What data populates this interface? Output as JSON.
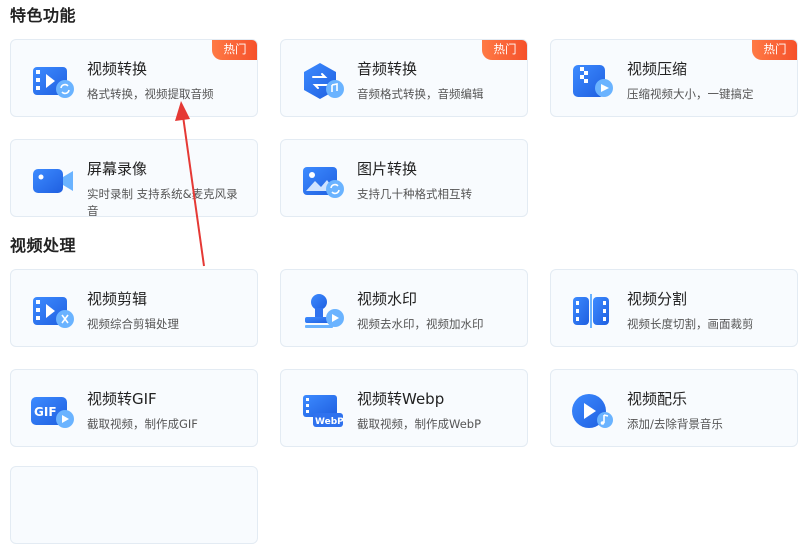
{
  "sections": [
    {
      "title": "特色功能"
    },
    {
      "title": "视频处理"
    }
  ],
  "featured": [
    {
      "title": "视频转换",
      "desc": "格式转换，视频提取音频",
      "badge": "热门",
      "icon": "video-convert-icon"
    },
    {
      "title": "音频转换",
      "desc": "音频格式转换，音频编辑",
      "badge": "热门",
      "icon": "audio-convert-icon"
    },
    {
      "title": "视频压缩",
      "desc": "压缩视频大小，一键搞定",
      "badge": "热门",
      "icon": "video-compress-icon"
    },
    {
      "title": "屏幕录像",
      "desc": "实时录制 支持系统&麦克风录音",
      "icon": "screen-record-icon"
    },
    {
      "title": "图片转换",
      "desc": "支持几十种格式相互转",
      "icon": "image-convert-icon"
    }
  ],
  "processing": [
    {
      "title": "视频剪辑",
      "desc": "视频综合剪辑处理",
      "icon": "video-cut-icon"
    },
    {
      "title": "视频水印",
      "desc": "视频去水印，视频加水印",
      "icon": "video-watermark-icon"
    },
    {
      "title": "视频分割",
      "desc": "视频长度切割，画面裁剪",
      "icon": "video-split-icon"
    },
    {
      "title": "视频转GIF",
      "desc": "截取视频，制作成GIF",
      "icon": "video-to-gif-icon"
    },
    {
      "title": "视频转Webp",
      "desc": "截取视频，制作成WebP",
      "icon": "video-to-webp-icon"
    },
    {
      "title": "视频配乐",
      "desc": "添加/去除背景音乐",
      "icon": "video-music-icon"
    }
  ],
  "icon_labels": {
    "gif": "GIF",
    "webp": "WebP"
  },
  "colors": {
    "accent": "#2f7bf5",
    "badge": "#f5502a",
    "annotation_arrow": "#e53935"
  }
}
